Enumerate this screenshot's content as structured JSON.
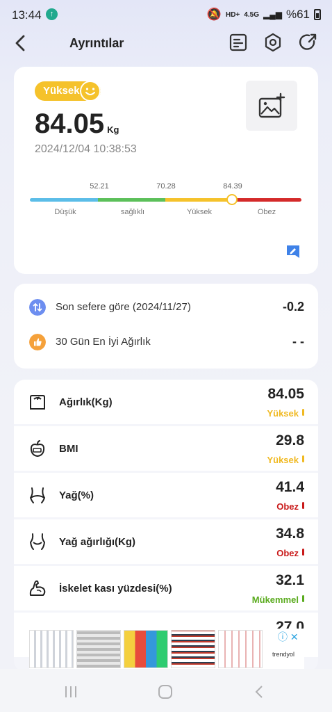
{
  "status_bar": {
    "time": "13:44",
    "network": "HD+",
    "network_type": "4.5G",
    "battery": "%61"
  },
  "header": {
    "title": "Ayrıntılar"
  },
  "summary": {
    "status_badge": "Yüksek",
    "weight": "84.05",
    "unit": "Kg",
    "datetime": "2024/12/04 10:38:53",
    "scale": {
      "thresholds": [
        "52.21",
        "70.28",
        "84.39"
      ],
      "labels": [
        "Düşük",
        "sağlıklı",
        "Yüksek",
        "Obez"
      ],
      "colors": [
        "#5bbde8",
        "#5cc05a",
        "#f5c22b",
        "#d42a2a"
      ]
    }
  },
  "compare": {
    "last_label": "Son sefere göre (2024/11/27)",
    "last_value": "-0.2",
    "best_label": "30 Gün En İyi Ağırlık",
    "best_value": "- -"
  },
  "metrics": [
    {
      "icon": "scale-icon",
      "label": "Ağırlık(Kg)",
      "value": "84.05",
      "status": "Yüksek",
      "color": "#f0b921"
    },
    {
      "icon": "bmi-icon",
      "label": "BMI",
      "value": "29.8",
      "status": "Yüksek",
      "color": "#f0b921"
    },
    {
      "icon": "body-fat-icon",
      "label": "Yağ(%)",
      "value": "41.4",
      "status": "Obez",
      "color": "#c91a1a"
    },
    {
      "icon": "fat-mass-icon",
      "label": "Yağ ağırlığı(Kg)",
      "value": "34.8",
      "status": "Obez",
      "color": "#c91a1a"
    },
    {
      "icon": "muscle-icon",
      "label": "İskelet kası yüzdesi(%)",
      "value": "32.1",
      "status": "Mükemmel",
      "color": "#5aab1e"
    },
    {
      "icon": "next-metric-icon",
      "label": "",
      "value": "27.0",
      "status": "",
      "color": "#222222"
    }
  ],
  "ad": {
    "brand": "trendyol"
  }
}
